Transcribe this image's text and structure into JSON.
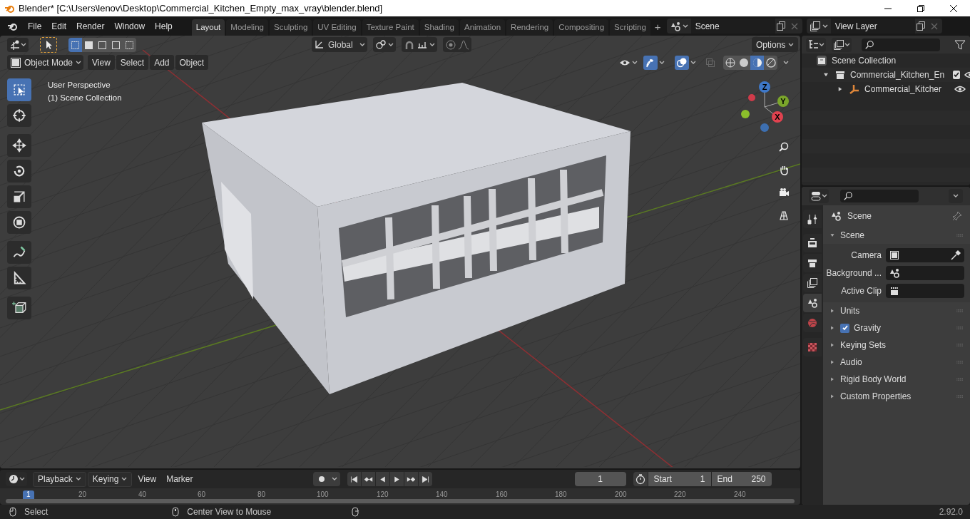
{
  "window": {
    "title": "Blender* [C:\\Users\\lenov\\Desktop\\Commercial_Kitchen_Empty_max_vray\\blender.blend]"
  },
  "menu": [
    "File",
    "Edit",
    "Render",
    "Window",
    "Help"
  ],
  "workspaces": [
    {
      "label": "Layout",
      "selected": true
    },
    {
      "label": "Modeling",
      "selected": false
    },
    {
      "label": "Sculpting",
      "selected": false
    },
    {
      "label": "UV Editing",
      "selected": false
    },
    {
      "label": "Texture Paint",
      "selected": false
    },
    {
      "label": "Shading",
      "selected": false
    },
    {
      "label": "Animation",
      "selected": false
    },
    {
      "label": "Rendering",
      "selected": false
    },
    {
      "label": "Compositing",
      "selected": false
    },
    {
      "label": "Scripting",
      "selected": false
    }
  ],
  "add_workspace": "+",
  "scene": "Scene",
  "view_layer": "View Layer",
  "tool_header": {
    "selection_modes": [
      {
        "selected": true
      },
      {
        "selected": false
      },
      {
        "selected": false
      },
      {
        "selected": false
      },
      {
        "selected": false
      }
    ],
    "orientation": "Global",
    "options": "Options"
  },
  "viewport": {
    "mode": "Object Mode",
    "menus": [
      "View",
      "Select",
      "Add",
      "Object"
    ],
    "info": [
      "User Perspective",
      "(1) Scene Collection"
    ],
    "tools": [
      {
        "kind": "select",
        "selected": true
      },
      {
        "kind": "cursor",
        "selected": false
      },
      {
        "kind": "move",
        "selected": false
      },
      {
        "kind": "rotate",
        "selected": false
      },
      {
        "kind": "scale",
        "selected": false
      },
      {
        "kind": "transform",
        "selected": false
      },
      {
        "kind": "annotate",
        "selected": false
      },
      {
        "kind": "measure",
        "selected": false
      },
      {
        "kind": "add",
        "selected": false
      }
    ],
    "shading": [
      {
        "selected": false
      },
      {
        "selected": false
      },
      {
        "selected": true
      },
      {
        "selected": false
      }
    ],
    "gizmo": [
      "Z",
      "Y",
      "X"
    ]
  },
  "outliner": {
    "root": "Scene Collection",
    "children": [
      {
        "label": "Commercial_Kitchen_En",
        "expanded": true,
        "checked": true,
        "children": [
          {
            "label": "Commercial_Kitcher",
            "expanded": false
          }
        ]
      }
    ]
  },
  "properties": {
    "tabs": [
      {
        "selected": false
      },
      {
        "selected": false
      },
      {
        "selected": false
      },
      {
        "selected": false
      },
      {
        "selected": true
      },
      {
        "selected": false
      },
      {
        "selected": false
      }
    ],
    "context": "Scene",
    "panel": {
      "title": "Scene",
      "expanded": true,
      "fields": [
        "Camera",
        "Background ...",
        "Active Clip"
      ]
    },
    "subpanels": [
      {
        "title": "Units",
        "expanded": false
      },
      {
        "title": "Gravity",
        "expanded": false,
        "checked": true
      },
      {
        "title": "Keying Sets",
        "expanded": false
      },
      {
        "title": "Audio",
        "expanded": false
      },
      {
        "title": "Rigid Body World",
        "expanded": false
      },
      {
        "title": "Custom Properties",
        "expanded": false
      }
    ]
  },
  "timeline": {
    "menus": [
      "Playback",
      "Keying",
      "View",
      "Marker"
    ],
    "current_frame": "1",
    "start_label": "Start",
    "start": "1",
    "end_label": "End",
    "end": "250",
    "ticks": [
      "1",
      "20",
      "40",
      "60",
      "80",
      "100",
      "120",
      "140",
      "160",
      "180",
      "200",
      "220",
      "240"
    ]
  },
  "status_bar": {
    "hints": [
      "Select",
      "Center View to Mouse"
    ],
    "version": "2.92.0"
  }
}
